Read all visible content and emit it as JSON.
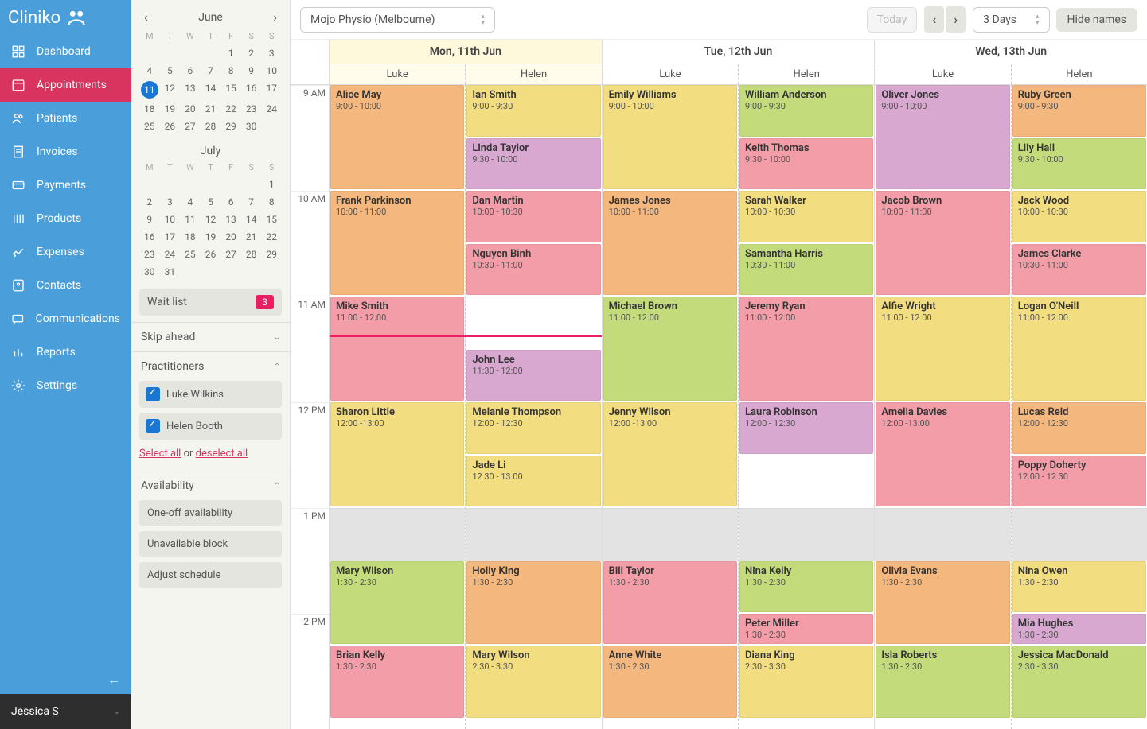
{
  "brand": "Cliniko",
  "nav": [
    {
      "label": "Dashboard",
      "icon": "dashboard"
    },
    {
      "label": "Appointments",
      "icon": "calendar",
      "active": true
    },
    {
      "label": "Patients",
      "icon": "patients"
    },
    {
      "label": "Invoices",
      "icon": "invoices"
    },
    {
      "label": "Payments",
      "icon": "payments"
    },
    {
      "label": "Products",
      "icon": "products"
    },
    {
      "label": "Expenses",
      "icon": "expenses"
    },
    {
      "label": "Contacts",
      "icon": "contacts"
    },
    {
      "label": "Communications",
      "icon": "comms"
    },
    {
      "label": "Reports",
      "icon": "reports"
    },
    {
      "label": "Settings",
      "icon": "settings"
    }
  ],
  "user": "Jessica S",
  "toolbar": {
    "location": "Mojo Physio (Melbourne)",
    "today": "Today",
    "range": "3 Days",
    "hide": "Hide names"
  },
  "miniCal": {
    "months": [
      {
        "name": "June",
        "dow": [
          "M",
          "T",
          "W",
          "T",
          "F",
          "S",
          "S"
        ],
        "firstDow": 4,
        "days": 30,
        "today": 11
      },
      {
        "name": "July",
        "dow": [
          "M",
          "T",
          "W",
          "T",
          "F",
          "S",
          "S"
        ],
        "firstDow": 6,
        "days": 31
      }
    ]
  },
  "waitlist": {
    "label": "Wait list",
    "count": "3"
  },
  "sections": {
    "skip": "Skip ahead",
    "prac": "Practitioners",
    "avail": "Availability",
    "selectAll": "Select all",
    "or": " or ",
    "deselectAll": "deselect all",
    "availBtns": [
      "One-off availability",
      "Unavailable block",
      "Adjust schedule"
    ]
  },
  "practitioners": [
    "Luke Wilkins",
    "Helen Booth"
  ],
  "pracShort": [
    "Luke",
    "Helen"
  ],
  "days": [
    {
      "title": "Mon, 11th Jun",
      "today": true
    },
    {
      "title": "Tue, 12th Jun"
    },
    {
      "title": "Wed, 13th Jun"
    }
  ],
  "hours": [
    "9 AM",
    "10 AM",
    "11 AM",
    "12 PM",
    "1 PM",
    "2 PM"
  ],
  "hourHeight": 133,
  "startHour": 9,
  "nowHour": 11.37,
  "break": {
    "start": 13,
    "end": 13.5
  },
  "appts": [
    [
      [
        {
          "name": "Alice May",
          "time": "9:00 - 10:00",
          "s": 9,
          "e": 10,
          "c": "orange"
        },
        {
          "name": "Frank Parkinson",
          "time": "10:00 - 11:00",
          "s": 10,
          "e": 11,
          "c": "orange"
        },
        {
          "name": "Mike Smith",
          "time": "11:00 - 12:00",
          "s": 11,
          "e": 12,
          "c": "pink"
        },
        {
          "name": "Sharon Little",
          "time": "12:00 -13:00",
          "s": 12,
          "e": 13,
          "c": "yellow"
        },
        {
          "name": "Mary Wilson",
          "time": "1:30 - 2:30",
          "s": 13.5,
          "e": 14.3,
          "c": "green"
        },
        {
          "name": "Brian Kelly",
          "time": "1:30 - 2:30",
          "s": 14.3,
          "e": 15,
          "c": "pink"
        }
      ],
      [
        {
          "name": "Ian Smith",
          "time": "9:00 - 9:30",
          "s": 9,
          "e": 9.5,
          "c": "yellow"
        },
        {
          "name": "Linda Taylor",
          "time": "9:30 - 10:00",
          "s": 9.5,
          "e": 10,
          "c": "purple"
        },
        {
          "name": "Dan Martin",
          "time": "10:00 - 10:30",
          "s": 10,
          "e": 10.5,
          "c": "pink"
        },
        {
          "name": "Nguyen Binh",
          "time": "10:30 - 11:00",
          "s": 10.5,
          "e": 11,
          "c": "pink"
        },
        {
          "name": "John Lee",
          "time": "11:30 - 12:00",
          "s": 11.5,
          "e": 12,
          "c": "purple"
        },
        {
          "name": "Melanie Thompson",
          "time": "12:00 - 12:30",
          "s": 12,
          "e": 12.5,
          "c": "yellow"
        },
        {
          "name": "Jade Li",
          "time": "12:30 - 13:00",
          "s": 12.5,
          "e": 13,
          "c": "yellow"
        },
        {
          "name": "Holly King",
          "time": "1:30 - 2:30",
          "s": 13.5,
          "e": 14.3,
          "c": "orange"
        },
        {
          "name": "Mary Wilson",
          "time": "2:30 - 3:30",
          "s": 14.3,
          "e": 15,
          "c": "yellow"
        }
      ]
    ],
    [
      [
        {
          "name": "Emily Williams",
          "time": "9:00 - 10:00",
          "s": 9,
          "e": 10,
          "c": "yellow"
        },
        {
          "name": "James Jones",
          "time": "10:00 - 11:00",
          "s": 10,
          "e": 11,
          "c": "orange"
        },
        {
          "name": "Michael Brown",
          "time": "11:00 - 12:00",
          "s": 11,
          "e": 12,
          "c": "green"
        },
        {
          "name": "Jenny Wilson",
          "time": "12:00 -13:00",
          "s": 12,
          "e": 13,
          "c": "yellow"
        },
        {
          "name": "Bill Taylor",
          "time": "1:30 - 2:30",
          "s": 13.5,
          "e": 14.3,
          "c": "pink"
        },
        {
          "name": "Anne White",
          "time": "1:30 - 2:30",
          "s": 14.3,
          "e": 15,
          "c": "orange"
        }
      ],
      [
        {
          "name": "William Anderson",
          "time": "9:00 - 9:30",
          "s": 9,
          "e": 9.5,
          "c": "green"
        },
        {
          "name": "Keith Thomas",
          "time": "9:30 - 10:00",
          "s": 9.5,
          "e": 10,
          "c": "pink"
        },
        {
          "name": "Sarah Walker",
          "time": "10:00 - 10:30",
          "s": 10,
          "e": 10.5,
          "c": "yellow"
        },
        {
          "name": "Samantha Harris",
          "time": "10:30 - 11:00",
          "s": 10.5,
          "e": 11,
          "c": "green"
        },
        {
          "name": "Jeremy Ryan",
          "time": "11:00 - 12:00",
          "s": 11,
          "e": 12,
          "c": "pink"
        },
        {
          "name": "Laura Robinson",
          "time": "12:00 - 12:30",
          "s": 12,
          "e": 12.5,
          "c": "purple"
        },
        {
          "name": "Nina Kelly",
          "time": "1:30 - 2:30",
          "s": 13.5,
          "e": 14,
          "c": "green"
        },
        {
          "name": "Peter Miller",
          "time": "1:30 - 2:30",
          "s": 14,
          "e": 14.3,
          "c": "pink"
        },
        {
          "name": "Diana King",
          "time": "2:30 - 3:30",
          "s": 14.3,
          "e": 15,
          "c": "yellow"
        }
      ]
    ],
    [
      [
        {
          "name": "Oliver Jones",
          "time": "9:00 - 10:00",
          "s": 9,
          "e": 10,
          "c": "purple"
        },
        {
          "name": "Jacob Brown",
          "time": "10:00 - 11:00",
          "s": 10,
          "e": 11,
          "c": "pink"
        },
        {
          "name": "Alfie Wright",
          "time": "11:00 - 12:00",
          "s": 11,
          "e": 12,
          "c": "yellow"
        },
        {
          "name": "Amelia Davies",
          "time": "12:00 -13:00",
          "s": 12,
          "e": 13,
          "c": "pink"
        },
        {
          "name": "Olivia Evans",
          "time": "1:30 - 2:30",
          "s": 13.5,
          "e": 14.3,
          "c": "orange"
        },
        {
          "name": "Isla Roberts",
          "time": "1:30 - 2:30",
          "s": 14.3,
          "e": 15,
          "c": "green"
        }
      ],
      [
        {
          "name": "Ruby Green",
          "time": "9:00 - 9:30",
          "s": 9,
          "e": 9.5,
          "c": "orange"
        },
        {
          "name": "Lily Hall",
          "time": "9:30 - 10:00",
          "s": 9.5,
          "e": 10,
          "c": "green"
        },
        {
          "name": "Jack Wood",
          "time": "10:00 - 10:30",
          "s": 10,
          "e": 10.5,
          "c": "yellow"
        },
        {
          "name": "James Clarke",
          "time": "10:30 - 11:00",
          "s": 10.5,
          "e": 11,
          "c": "pink"
        },
        {
          "name": "Logan O'Neill",
          "time": "11:00 - 12:00",
          "s": 11,
          "e": 12,
          "c": "yellow"
        },
        {
          "name": "Lucas Reid",
          "time": "12:00 - 12:30",
          "s": 12,
          "e": 12.5,
          "c": "orange"
        },
        {
          "name": "Poppy Doherty",
          "time": "12:00 - 12:30",
          "s": 12.5,
          "e": 13,
          "c": "pink"
        },
        {
          "name": "Nina Owen",
          "time": "1:30 - 2:30",
          "s": 13.5,
          "e": 14,
          "c": "yellow"
        },
        {
          "name": "Mia Hughes",
          "time": "1:30 - 2:30",
          "s": 14,
          "e": 14.3,
          "c": "purple"
        },
        {
          "name": "Jessica MacDonald",
          "time": "2:30 - 3:30",
          "s": 14.3,
          "e": 15,
          "c": "green"
        }
      ]
    ]
  ]
}
